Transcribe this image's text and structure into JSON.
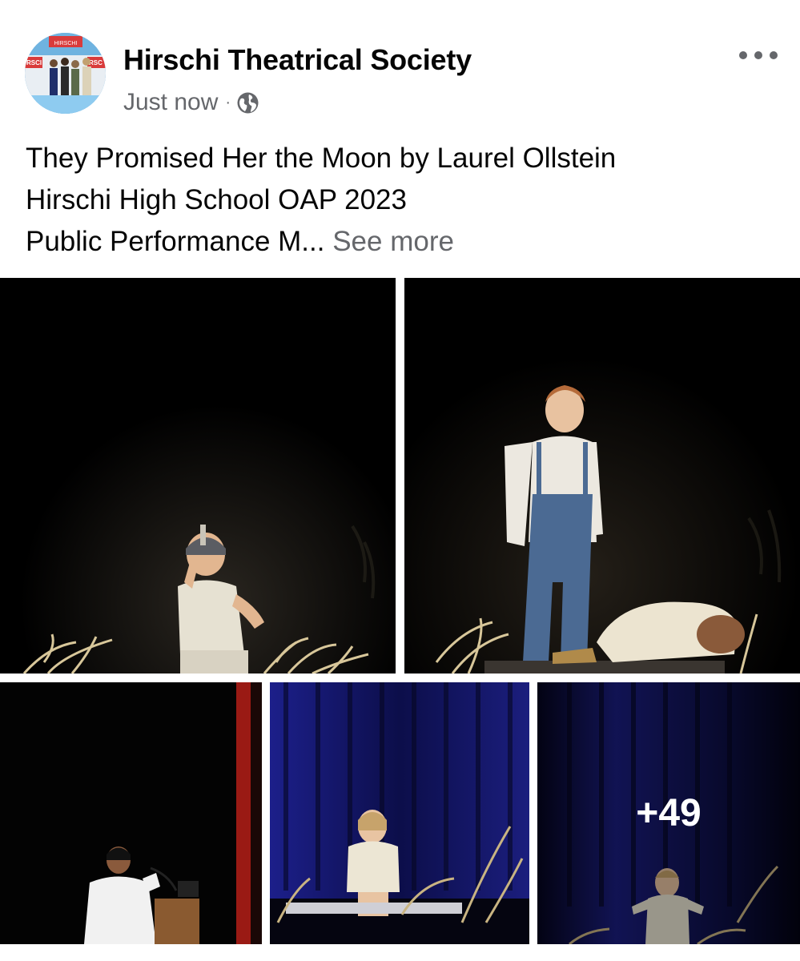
{
  "post": {
    "page_name": "Hirschi Theatrical Society",
    "timestamp": "Just now",
    "separator": "·",
    "privacy_icon": "globe-icon",
    "more_icon": "more-options-icon",
    "text_lines": [
      "They Promised Her the Moon by Laurel Ollstein",
      "Hirschi High School OAP 2023",
      "Public Performance M..."
    ],
    "see_more_label": "See more"
  },
  "avatar": {
    "banner_text": "HIRSCHI",
    "left_sign": "RSCI",
    "right_sign": "RSC"
  },
  "photos": {
    "more_count_label": "+49"
  },
  "colors": {
    "text_primary": "#050505",
    "text_secondary": "#65676b",
    "stage_black": "#000000",
    "curtain_blue": "#1a1a7a",
    "curtain_red": "#9a1a14"
  }
}
